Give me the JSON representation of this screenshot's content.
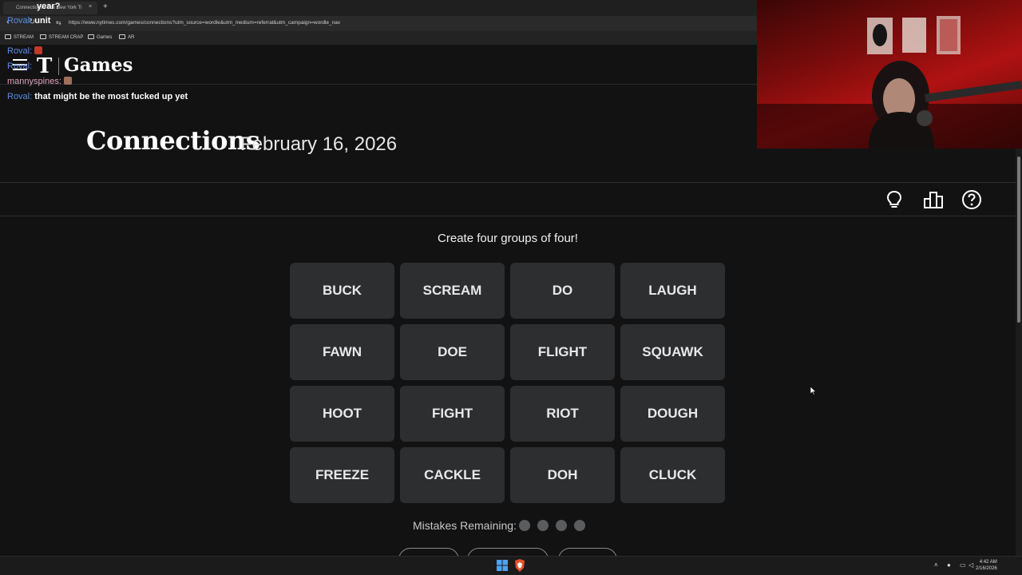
{
  "browser": {
    "tab_title": "Connections - The New York Ti",
    "tab_close": "×",
    "new_tab": "+",
    "url": "https://www.nytimes.com/games/connections?utm_source=wordle&utm_medium=referral&utm_campaign=wordle_nav",
    "bookmarks": [
      "STREAM",
      "STREAM CRAP",
      "Games",
      "AR"
    ]
  },
  "header": {
    "logo": "T",
    "title": "Games"
  },
  "chat": [
    {
      "user": "Roval",
      "sep": ":",
      "message": "year?"
    },
    {
      "user": "Roval",
      "sep": ":",
      "message": "unit"
    },
    {
      "user": "Roval",
      "sep": ":",
      "message": ""
    },
    {
      "user": "Roval",
      "sep": ":",
      "message": ""
    },
    {
      "user": "mannyspines",
      "sep": ":",
      "message": ""
    },
    {
      "user": "Roval",
      "sep": ":",
      "message": "that might be the most fucked up yet"
    }
  ],
  "game": {
    "title": "Connections",
    "date": "February 16, 2026",
    "instructions": "Create four groups of four!",
    "tiles": [
      "BUCK",
      "SCREAM",
      "DO",
      "LAUGH",
      "FAWN",
      "DOE",
      "FLIGHT",
      "SQUAWK",
      "HOOT",
      "FIGHT",
      "RIOT",
      "DOUGH",
      "FREEZE",
      "CACKLE",
      "DOH",
      "CLUCK"
    ],
    "mistakes_label": "Mistakes Remaining:",
    "mistakes_remaining": 4
  },
  "toolbar": {
    "icons": [
      "lightbulb-icon",
      "leaderboard-icon",
      "help-icon"
    ]
  },
  "tray": {
    "time": "4:42 AM",
    "date": "2/16/2026"
  }
}
